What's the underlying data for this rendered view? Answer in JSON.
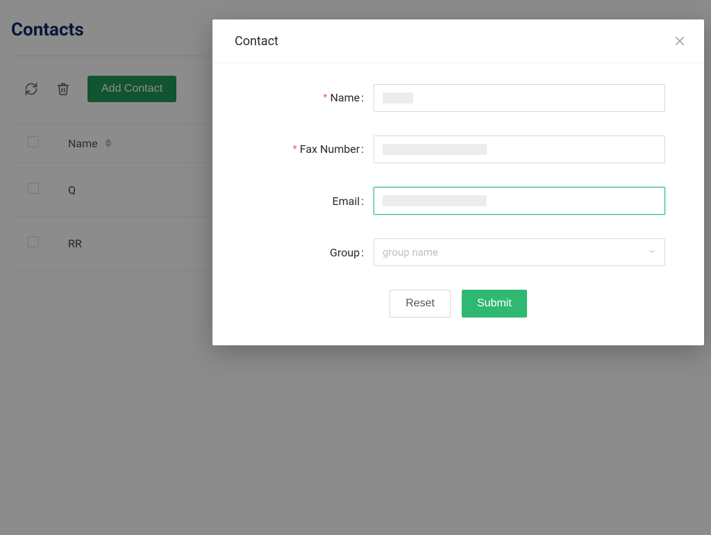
{
  "page": {
    "title": "Contacts",
    "toolbar": {
      "add_label": "Add Contact"
    },
    "table": {
      "columns": {
        "name": "Name"
      },
      "rows": [
        {
          "name": "Q"
        },
        {
          "name": "RR"
        }
      ]
    }
  },
  "modal": {
    "title": "Contact",
    "fields": {
      "name": {
        "label": "Name",
        "required": true,
        "value": ""
      },
      "fax": {
        "label": "Fax Number",
        "required": true,
        "value": ""
      },
      "email": {
        "label": "Email",
        "required": false,
        "value": "",
        "focused": true
      },
      "group": {
        "label": "Group",
        "required": false,
        "placeholder": "group name"
      }
    },
    "buttons": {
      "reset": "Reset",
      "submit": "Submit"
    }
  },
  "colors": {
    "brand_green": "#2eb872",
    "header_green": "#1f9a58",
    "title_navy": "#0c2a68"
  }
}
